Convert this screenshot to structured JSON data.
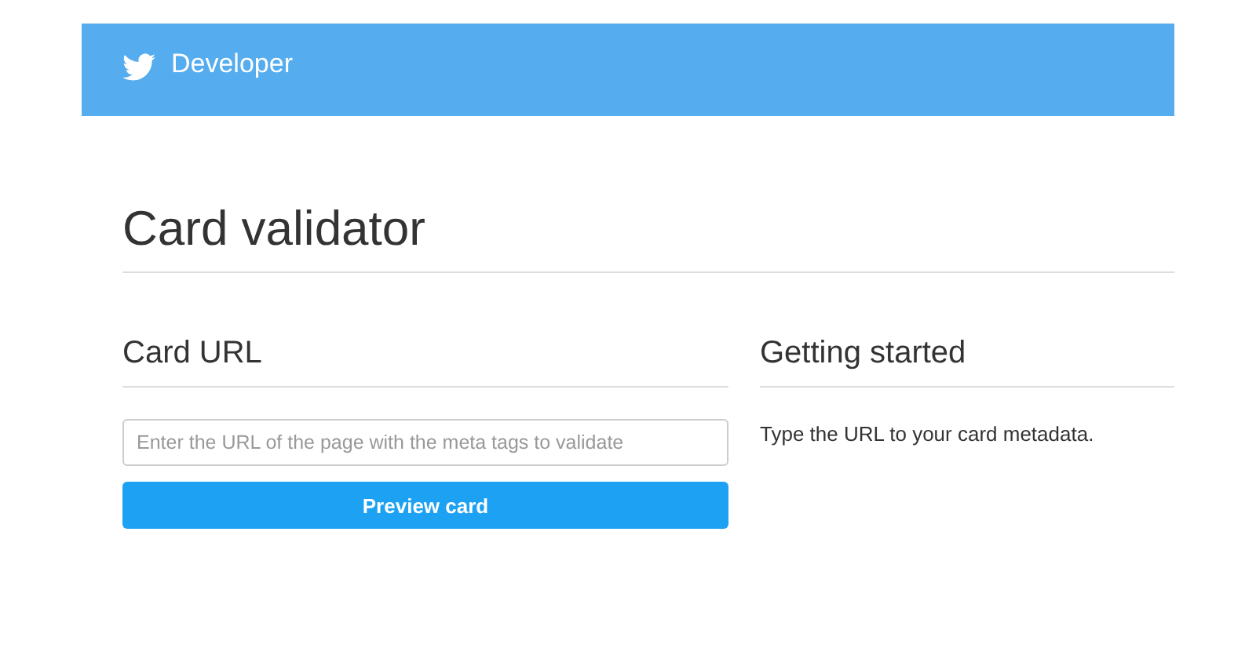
{
  "header": {
    "title": "Developer"
  },
  "page": {
    "title": "Card validator"
  },
  "card_url": {
    "heading": "Card URL",
    "input": {
      "placeholder": "Enter the URL of the page with the meta tags to validate"
    },
    "button": "Preview card"
  },
  "getting_started": {
    "heading": "Getting started",
    "text": "Type the URL to your card metadata."
  }
}
